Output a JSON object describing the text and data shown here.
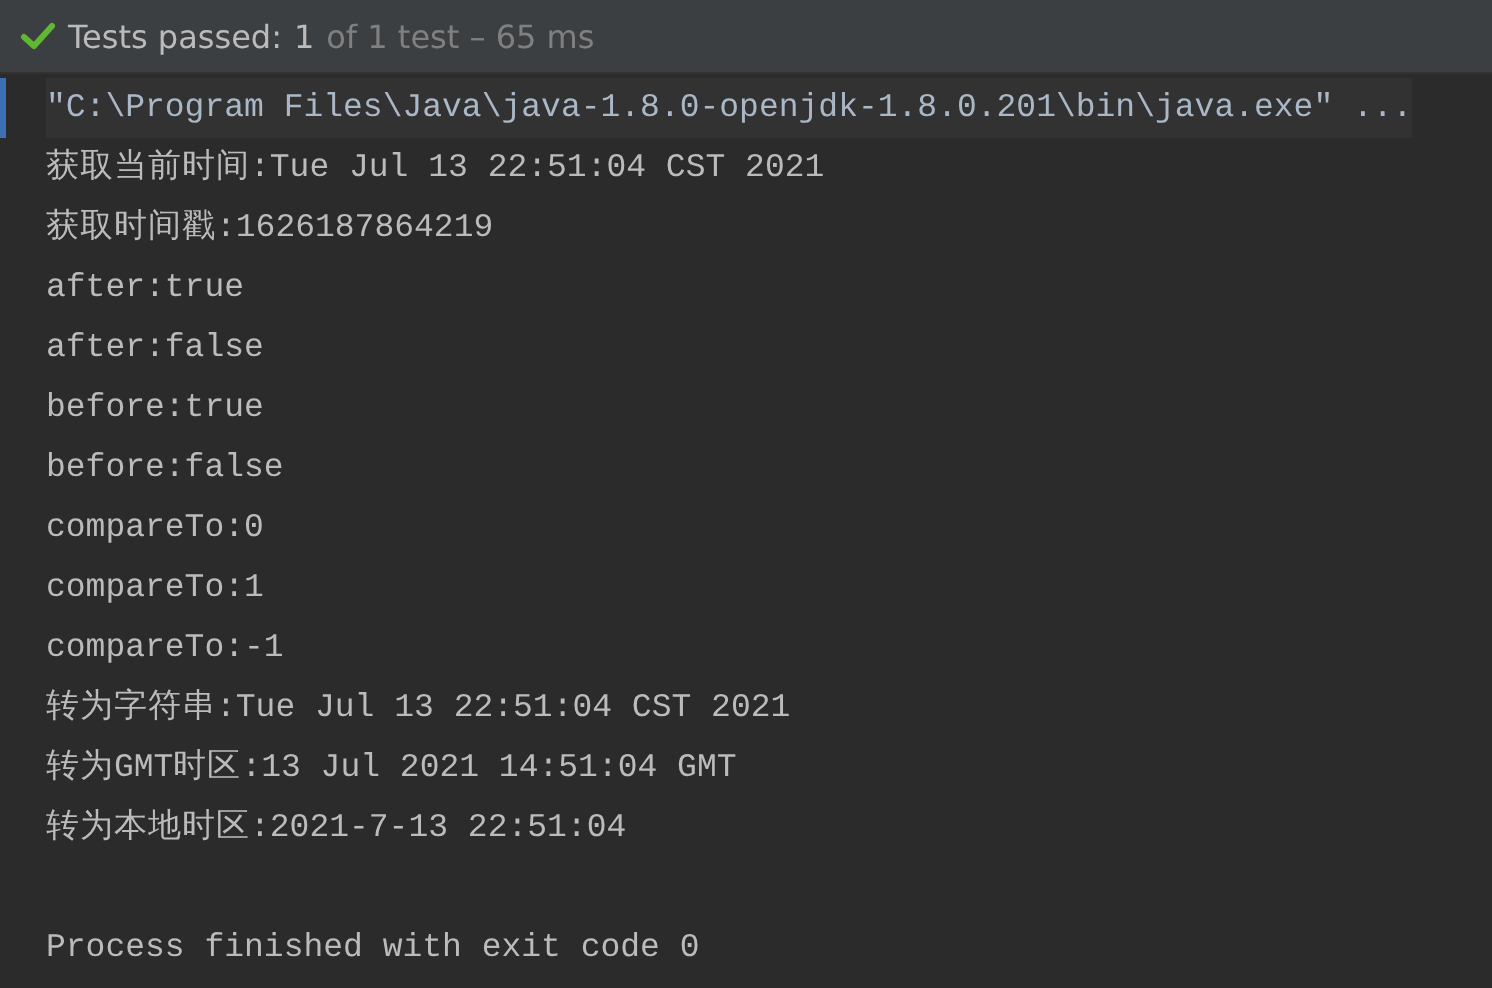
{
  "header": {
    "status": "Tests passed:",
    "count": "1",
    "detail": "of 1 test – 65 ms",
    "passed": true
  },
  "output": [
    {
      "kind": "command",
      "text": "\"C:\\Program Files\\Java\\java-1.8.0-openjdk-1.8.0.201\\bin\\java.exe\" ...",
      "selected": true
    },
    {
      "kind": "text",
      "text": "获取当前时间:Tue Jul 13 22:51:04 CST 2021"
    },
    {
      "kind": "text",
      "text": "获取时间戳:1626187864219"
    },
    {
      "kind": "text",
      "text": "after:true"
    },
    {
      "kind": "text",
      "text": "after:false"
    },
    {
      "kind": "text",
      "text": "before:true"
    },
    {
      "kind": "text",
      "text": "before:false"
    },
    {
      "kind": "text",
      "text": "compareTo:0"
    },
    {
      "kind": "text",
      "text": "compareTo:1"
    },
    {
      "kind": "text",
      "text": "compareTo:-1"
    },
    {
      "kind": "text",
      "text": "转为字符串:Tue Jul 13 22:51:04 CST 2021"
    },
    {
      "kind": "text",
      "text": "转为GMT时区:13 Jul 2021 14:51:04 GMT"
    },
    {
      "kind": "text",
      "text": "转为本地时区:2021-7-13 22:51:04"
    },
    {
      "kind": "blank"
    },
    {
      "kind": "text",
      "text": "Process finished with exit code 0"
    }
  ]
}
